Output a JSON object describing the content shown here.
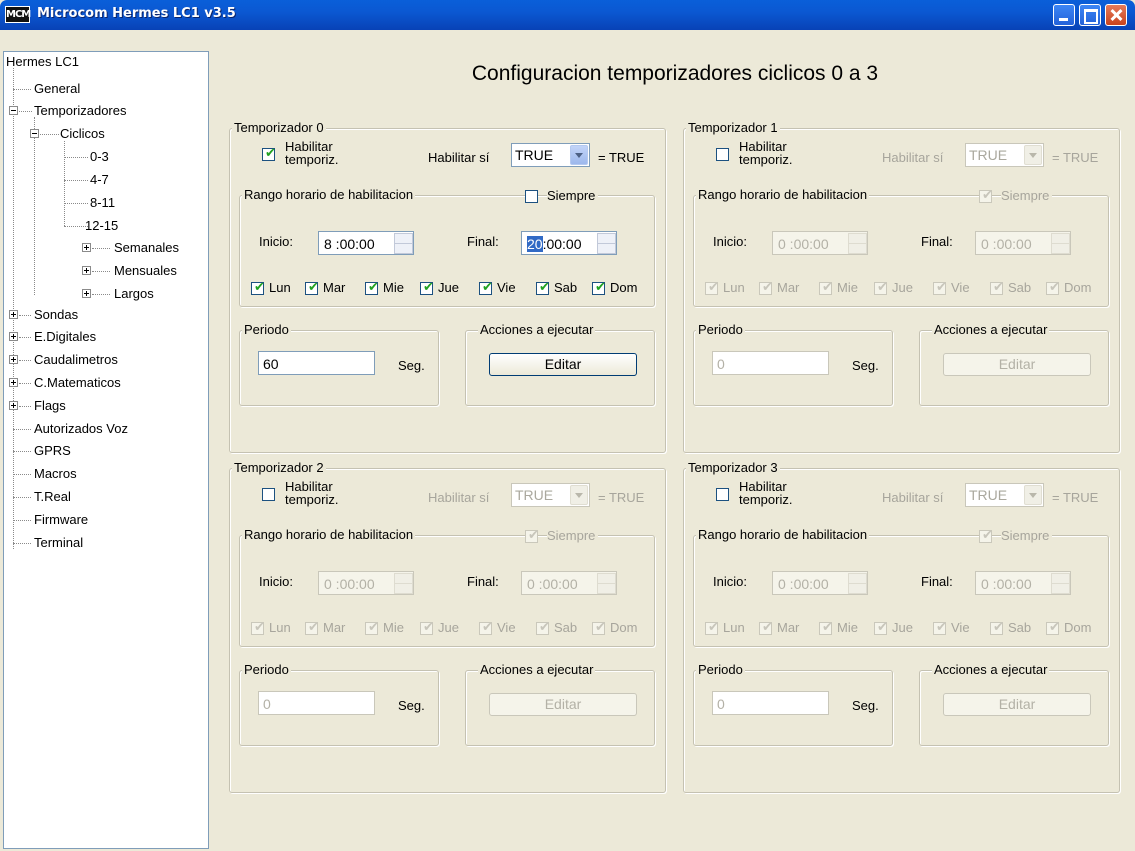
{
  "window": {
    "title": "Microcom Hermes LC1 v3.5",
    "icon_text": "MCM"
  },
  "tree": {
    "root": "Hermes LC1",
    "general": "General",
    "temporizadores": "Temporizadores",
    "ciclicos": "Ciclicos",
    "c03": "0-3",
    "c47": "4-7",
    "c811": "8-11",
    "c1215": "12-15",
    "semanales": "Semanales",
    "mensuales": "Mensuales",
    "largos": "Largos",
    "sondas": "Sondas",
    "edigitales": "E.Digitales",
    "caudalimetros": "Caudalimetros",
    "cmatematicos": "C.Matematicos",
    "flags": "Flags",
    "autorizados": "Autorizados Voz",
    "gprs": "GPRS",
    "macros": "Macros",
    "treal": "T.Real",
    "firmware": "Firmware",
    "terminal": "Terminal"
  },
  "main": {
    "title": "Configuracion temporizadores ciclicos  0 a 3"
  },
  "labels": {
    "habilitar_line1": "Habilitar",
    "habilitar_line2": "temporiz.",
    "habilitar_si": "Habilitar sí",
    "equals_true": "= TRUE",
    "rango": "Rango horario de habilitacion",
    "siempre": "Siempre",
    "inicio": "Inicio:",
    "final": "Final:",
    "periodo": "Periodo",
    "seg": "Seg.",
    "acciones": "Acciones a ejecutar",
    "editar": "Editar",
    "days": [
      "Lun",
      "Mar",
      "Mie",
      "Jue",
      "Vie",
      "Sab",
      "Dom"
    ]
  },
  "timers": [
    {
      "title": "Temporizador  0",
      "enabled": true,
      "condition": "TRUE",
      "siempre": false,
      "inicio": "8 :00:00",
      "final_sel": "20",
      "final_rest": ":00:00",
      "periodo": "60"
    },
    {
      "title": "Temporizador  1",
      "enabled": false,
      "condition": "TRUE",
      "siempre": true,
      "inicio": "0 :00:00",
      "final": "0 :00:00",
      "periodo": "0"
    },
    {
      "title": "Temporizador  2",
      "enabled": false,
      "condition": "TRUE",
      "siempre": true,
      "inicio": "0 :00:00",
      "final": "0 :00:00",
      "periodo": "0"
    },
    {
      "title": "Temporizador  3",
      "enabled": false,
      "condition": "TRUE",
      "siempre": true,
      "inicio": "0 :00:00",
      "final": "0 :00:00",
      "periodo": "0"
    }
  ],
  "colors": {
    "titlebar": "#0b58d2",
    "face": "#ece9d8",
    "checkmark": "#21a121",
    "selection": "#316ac5"
  }
}
